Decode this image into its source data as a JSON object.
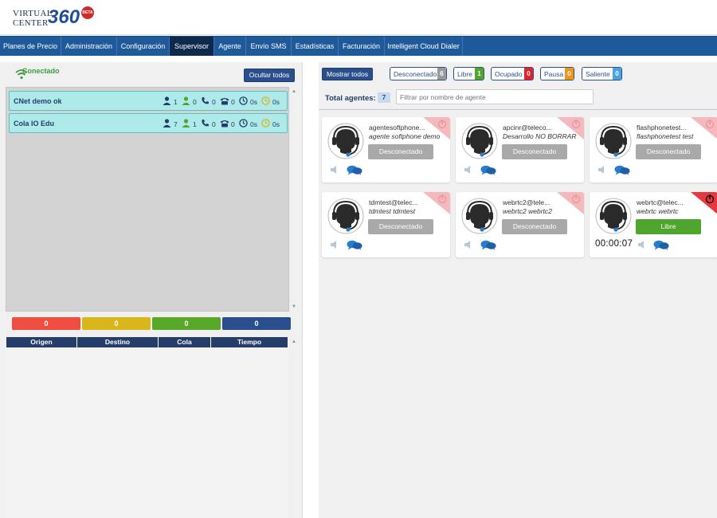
{
  "logo": {
    "line1": "VIRTUAL",
    "line2": "CENTER",
    "number": "360",
    "badge": "BETA"
  },
  "nav": {
    "items": [
      {
        "label": "Planes de Precio"
      },
      {
        "label": "Administración"
      },
      {
        "label": "Configuración"
      },
      {
        "label": "Supervisor"
      },
      {
        "label": "Agente"
      },
      {
        "label": "Envío SMS"
      },
      {
        "label": "Estadísticas"
      },
      {
        "label": "Facturación"
      },
      {
        "label": "Intelligent Cloud Dialer"
      }
    ],
    "active": "Supervisor"
  },
  "left": {
    "status": "Conectado",
    "hide_all_label": "Ocultar todos",
    "queues": [
      {
        "name": "CNet demo ok",
        "agents": "1",
        "free": "0",
        "calls": "0",
        "waiting": "0",
        "t1": "0s",
        "t2": "0s"
      },
      {
        "name": "Cola IO Edu",
        "agents": "7",
        "free": "1",
        "calls": "0",
        "waiting": "0",
        "t1": "0s",
        "t2": "0s"
      }
    ],
    "counters": [
      "0",
      "0",
      "0",
      "0"
    ],
    "table_headers": [
      "Origen",
      "Destino",
      "Cola",
      "Tiempo"
    ]
  },
  "right": {
    "show_all_label": "Mostrar todos",
    "legend": [
      {
        "label": "Desconectado",
        "count": "6",
        "color": "#9a9a9a"
      },
      {
        "label": "Libre",
        "count": "1",
        "color": "#4fa52e"
      },
      {
        "label": "Ocupado",
        "count": "0",
        "color": "#e3232b"
      },
      {
        "label": "Pausa",
        "count": "0",
        "color": "#f0961e"
      },
      {
        "label": "Saliente",
        "count": "0",
        "color": "#4aa3df"
      }
    ],
    "total_label": "Total agentes:",
    "total_count": "7",
    "filter_placeholder": "Filtrar por nombre de agente",
    "agents": [
      {
        "ext": "agentesoftphone...",
        "name": "agente softphone demo",
        "state": "Desconectado",
        "timer": ""
      },
      {
        "ext": "apcinr@teleco...",
        "name": "Desarrollo NO BORRAR",
        "state": "Desconectado",
        "timer": ""
      },
      {
        "ext": "flashphonetest...",
        "name": "flashphonetest test",
        "state": "Desconectado",
        "timer": ""
      },
      {
        "ext": "tdmtest@telec...",
        "name": "tdmtest tdmtest",
        "state": "Desconectado",
        "timer": ""
      },
      {
        "ext": "webrtc2@tele...",
        "name": "webrtc2 webrtc2",
        "state": "Desconectado",
        "timer": ""
      },
      {
        "ext": "webrtc@telec...",
        "name": "webrtc webrtc",
        "state": "Libre",
        "timer": "00:00:07"
      }
    ]
  },
  "colors": {
    "nav_bg": "#1e5a9a",
    "nav_active": "#0d2a4d",
    "queue_row": "#aeeaea",
    "disconnected": "#a9a9a9",
    "free": "#4fa52e",
    "counter_red": "#f04d43",
    "counter_yellow": "#d9b61c",
    "counter_green": "#5aa829",
    "counter_blue": "#2b4f8c"
  }
}
